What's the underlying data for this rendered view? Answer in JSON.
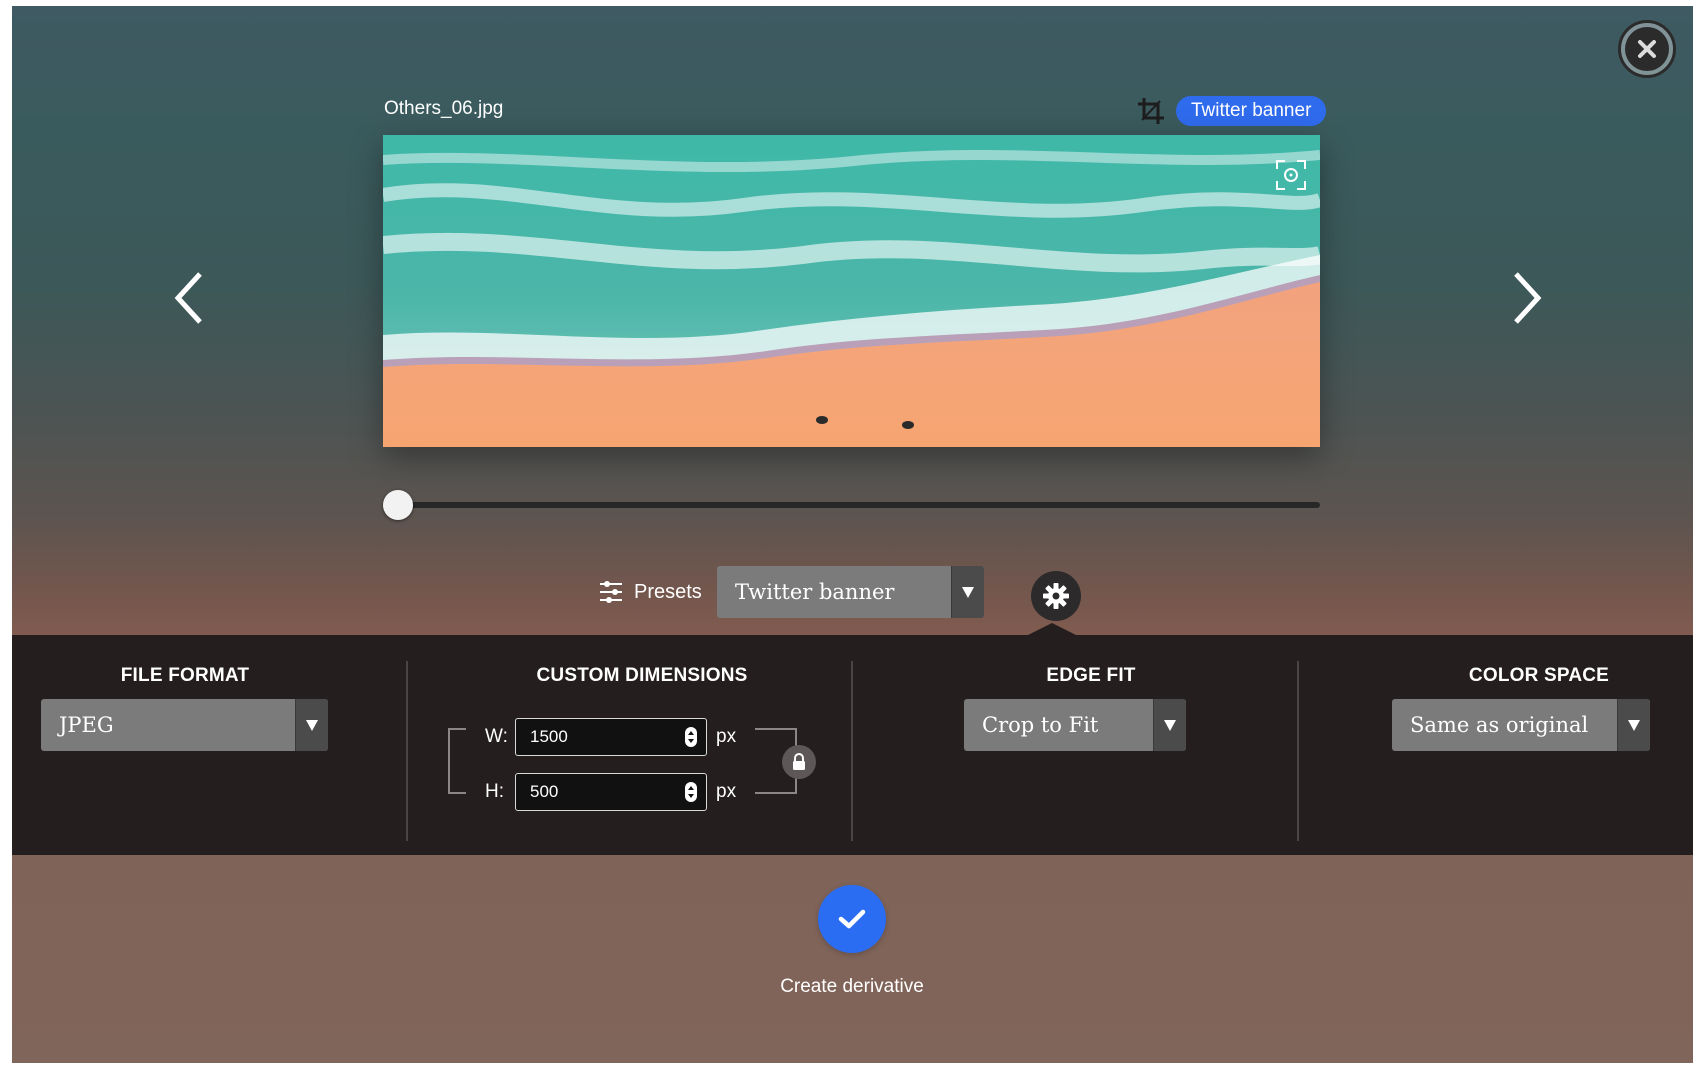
{
  "window": {
    "close_icon": "close-circle-icon"
  },
  "header": {
    "filename": "Others_06.jpg",
    "crop_icon": "crop-icon",
    "active_preset_badge": "Twitter banner"
  },
  "preview": {
    "focus_icon": "focus-frame-icon",
    "prev_icon": "chevron-left-icon",
    "next_icon": "chevron-right-icon",
    "zoom_fraction": 0.0
  },
  "toolbar": {
    "presets_label": "Presets",
    "presets_icon": "sliders-icon",
    "preset_select_value": "Twitter banner",
    "settings_icon": "gear-icon"
  },
  "settings": {
    "file_format": {
      "title": "FILE FORMAT",
      "value": "JPEG"
    },
    "dimensions": {
      "title": "CUSTOM DIMENSIONS",
      "width_label": "W:",
      "width_value": "1500",
      "height_label": "H:",
      "height_value": "500",
      "unit": "px",
      "lock_icon": "lock-icon"
    },
    "edge_fit": {
      "title": "EDGE FIT",
      "value": "Crop to Fit"
    },
    "color_space": {
      "title": "COLOR SPACE",
      "value": "Same as original"
    }
  },
  "action": {
    "confirm_icon": "checkmark-icon",
    "label": "Create derivative"
  },
  "colors": {
    "accent": "#2f6bed",
    "panel": "#241e1e",
    "select_bg": "#7b7b7b"
  }
}
